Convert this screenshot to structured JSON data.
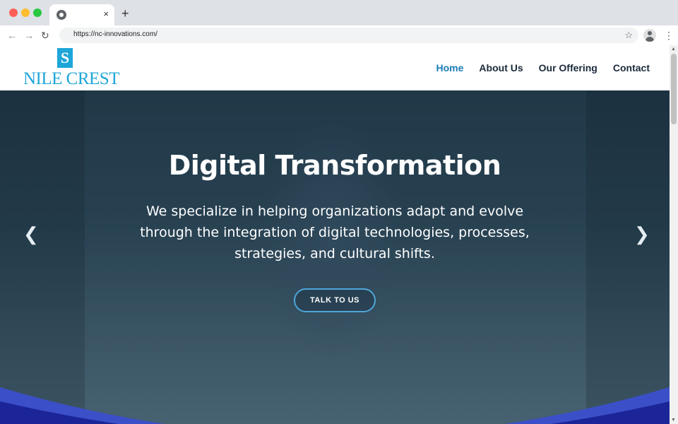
{
  "browser": {
    "tab_close": "×",
    "new_tab": "+",
    "url": "https://nc-innovations.com/",
    "icons": [
      "back-icon",
      "forward-icon",
      "reload-icon",
      "star-icon",
      "profile-icon",
      "menu-icon"
    ]
  },
  "header": {
    "logo_text": "NILE CREST",
    "logo_mark": "S",
    "nav": [
      "Home",
      "About Us",
      "Our Offering",
      "Contact"
    ],
    "active_nav": "Home"
  },
  "hero": {
    "title": "Digital Transformation",
    "subtitle": "We specialize in helping organizations adapt and evolve through the integration of digital technologies, processes, strategies, and cultural shifts.",
    "cta": "TALK TO US",
    "prev_icon": "chevron-left-icon",
    "next_icon": "chevron-right-icon"
  },
  "colors": {
    "brand": "#1ea6d8",
    "nav_active": "#1a7bb4",
    "wave_light": "#3b4fc8",
    "wave_dark": "#1b2597",
    "cta_border": "#4fa6d9"
  }
}
